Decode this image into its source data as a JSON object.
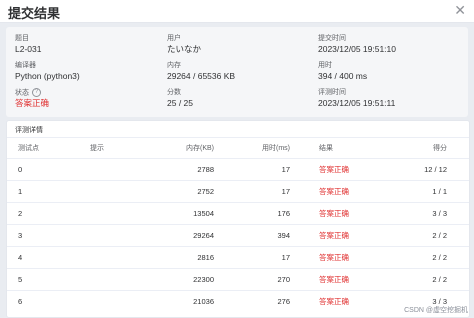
{
  "dialog": {
    "title": "提交结果",
    "close": "✕"
  },
  "info": {
    "problem_label": "题目",
    "problem_value": "L2-031",
    "user_label": "用户",
    "user_value": "たいなか",
    "submit_time_label": "提交时间",
    "submit_time_value": "2023/12/05 19:51:10",
    "compiler_label": "编译器",
    "compiler_value": "Python (python3)",
    "memory_label": "内存",
    "memory_value": "29264 / 65536 KB",
    "time_label": "用时",
    "time_value": "394 / 400 ms",
    "status_label": "状态",
    "status_hint_icon": "?",
    "status_value": "答案正确",
    "score_label": "分数",
    "score_value": "25 / 25",
    "judge_time_label": "评测时间",
    "judge_time_value": "2023/12/05 19:51:11"
  },
  "details": {
    "title": "评测详情",
    "columns": {
      "case": "测试点",
      "hint": "提示",
      "memory": "内存(KB)",
      "time": "用时(ms)",
      "result": "结果",
      "score": "得分"
    },
    "rows": [
      {
        "case": "0",
        "hint": "",
        "memory": "2788",
        "time": "17",
        "result": "答案正确",
        "score": "12 / 12"
      },
      {
        "case": "1",
        "hint": "",
        "memory": "2752",
        "time": "17",
        "result": "答案正确",
        "score": "1 / 1"
      },
      {
        "case": "2",
        "hint": "",
        "memory": "13504",
        "time": "176",
        "result": "答案正确",
        "score": "3 / 3"
      },
      {
        "case": "3",
        "hint": "",
        "memory": "29264",
        "time": "394",
        "result": "答案正确",
        "score": "2 / 2"
      },
      {
        "case": "4",
        "hint": "",
        "memory": "2816",
        "time": "17",
        "result": "答案正确",
        "score": "2 / 2"
      },
      {
        "case": "5",
        "hint": "",
        "memory": "22300",
        "time": "270",
        "result": "答案正确",
        "score": "2 / 2"
      },
      {
        "case": "6",
        "hint": "",
        "memory": "21036",
        "time": "276",
        "result": "答案正确",
        "score": "3 / 3"
      }
    ]
  },
  "watermark": "CSDN @虚空挖掘机",
  "colors": {
    "accepted": "#e03131",
    "panel_bg": "#f5f6f8"
  }
}
